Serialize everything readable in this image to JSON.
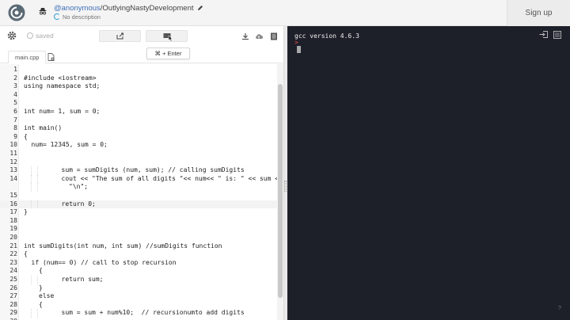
{
  "header": {
    "username": "@anonymous",
    "separator": "/",
    "repl_name": "OutlyingNastyDevelopment",
    "description": "No description",
    "signup_label": "Sign up"
  },
  "toolbar": {
    "saved_label": "saved",
    "run_tooltip": "⌘ + Enter"
  },
  "tabs": [
    {
      "label": "main.cpp"
    }
  ],
  "editor": {
    "active_line": 16,
    "lines": [
      {
        "n": "1",
        "text": "",
        "indent": 0
      },
      {
        "n": "2",
        "text": "#include <iostream>",
        "indent": 0
      },
      {
        "n": "3",
        "text": "using namespace std;",
        "indent": 0
      },
      {
        "n": "4",
        "text": "",
        "indent": 0
      },
      {
        "n": "5",
        "text": "",
        "indent": 0
      },
      {
        "n": "6",
        "text": "int num= 1, sum = 0;",
        "indent": 0
      },
      {
        "n": "7",
        "text": "",
        "indent": 0
      },
      {
        "n": "8",
        "text": "int main()",
        "indent": 0
      },
      {
        "n": "9",
        "text": "{",
        "indent": 0
      },
      {
        "n": "10",
        "text": "num= 12345, sum = 0;",
        "indent": 1
      },
      {
        "n": "11",
        "text": "",
        "indent": 0
      },
      {
        "n": "12",
        "text": "",
        "indent": 0
      },
      {
        "n": "13",
        "text": "sum = sumDigits (num, sum); // calling sumDigits",
        "indent": 5
      },
      {
        "n": "14",
        "text": "cout << \"The sum of all digits \"<< num<< \" is: \" << sum <<",
        "indent": 5
      },
      {
        "n": "",
        "text": "\"\\n\";",
        "indent": 6
      },
      {
        "n": "15",
        "text": "",
        "indent": 0
      },
      {
        "n": "16",
        "text": "return 0;",
        "indent": 5
      },
      {
        "n": "17",
        "text": "}",
        "indent": 0
      },
      {
        "n": "18",
        "text": "",
        "indent": 0
      },
      {
        "n": "19",
        "text": "",
        "indent": 0
      },
      {
        "n": "20",
        "text": "",
        "indent": 0
      },
      {
        "n": "21",
        "text": "int sumDigits(int num, int sum) //sumDigits function",
        "indent": 0
      },
      {
        "n": "22",
        "text": "{",
        "indent": 0
      },
      {
        "n": "23",
        "text": "if (num== 0) // call to stop recursion",
        "indent": 1
      },
      {
        "n": "24",
        "text": "{",
        "indent": 2
      },
      {
        "n": "25",
        "text": "return sum;",
        "indent": 5
      },
      {
        "n": "26",
        "text": "}",
        "indent": 2
      },
      {
        "n": "27",
        "text": "else",
        "indent": 2
      },
      {
        "n": "28",
        "text": "{",
        "indent": 2
      },
      {
        "n": "29",
        "text": "sum = sum + num%10;  // recursionumto add digits",
        "indent": 5
      },
      {
        "n": "30",
        "text": "",
        "indent": 0
      }
    ]
  },
  "terminal": {
    "version_line": "gcc version 4.6.3",
    "prompt_symbol": ">",
    "help_label": "?"
  },
  "colors": {
    "terminal_bg": "#1d1f29",
    "prompt": "#e34b4b",
    "link": "#3d6fb6",
    "accent": "#2aa1d8"
  }
}
